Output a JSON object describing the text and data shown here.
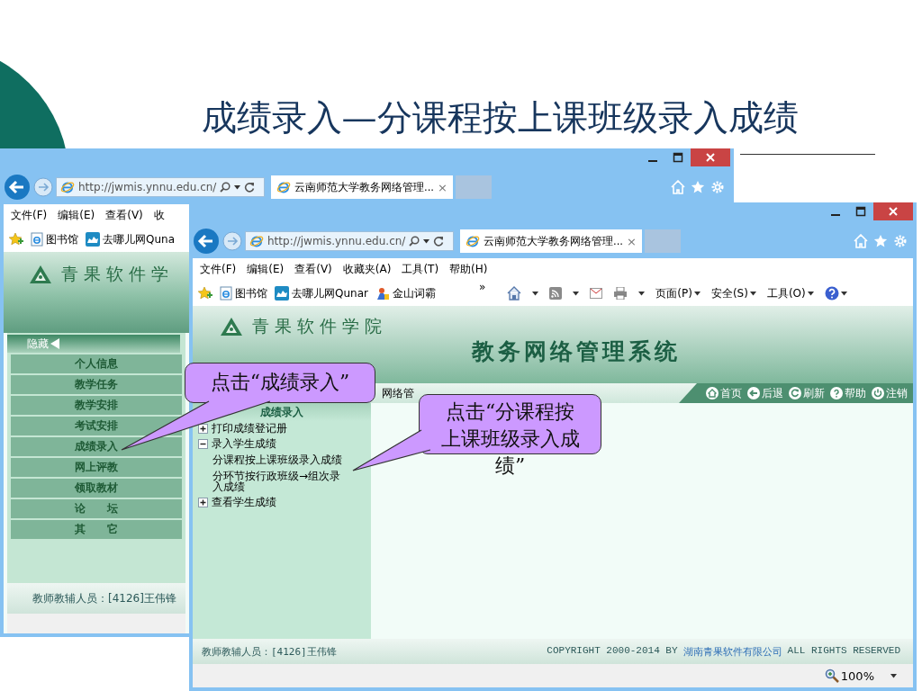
{
  "slide": {
    "title": "成绩录入—分课程按上课班级录入成绩"
  },
  "back_window": {
    "address": "http://jwmis.ynnu.edu.cn/",
    "tab": {
      "title": "云南师范大学教务网络管理...",
      "close": "×"
    },
    "menu": [
      "文件(F)",
      "编辑(E)",
      "查看(V)",
      "收"
    ],
    "favorites": [
      "图书馆",
      "去哪儿网Quna"
    ],
    "logo_text": "青果软件学",
    "sidebar": {
      "toggle": "隐藏",
      "items": [
        "个人信息",
        "教学任务",
        "教学安排",
        "考试安排",
        "成绩录入",
        "网上评教",
        "领取教材",
        "论　　坛",
        "其　　它"
      ]
    },
    "footer": "教师教辅人员：[4126]王伟锋"
  },
  "front_window": {
    "address": "http://jwmis.ynnu.edu.cn/",
    "tab": {
      "title": "云南师范大学教务网络管理...",
      "close": "×"
    },
    "menu": [
      "文件(F)",
      "编辑(E)",
      "查看(V)",
      "收藏夹(A)",
      "工具(T)",
      "帮助(H)"
    ],
    "favorites": [
      "图书馆",
      "去哪儿网Qunar",
      "金山词霸"
    ],
    "more": "»",
    "command_bar": [
      "页面(P)",
      "安全(S)",
      "工具(O)"
    ],
    "logo_text": "青果软件学院",
    "system_title": "教务网络管理系统",
    "location": "网络管",
    "nav": [
      "首页",
      "后退",
      "刷新",
      "帮助",
      "注销"
    ],
    "tree": {
      "title": "成绩录入",
      "items": [
        {
          "label": "打印成绩登记册",
          "expanded": false
        },
        {
          "label": "录入学生成绩",
          "expanded": true,
          "children": [
            {
              "label": "分课程按上课班级录入成绩"
            },
            {
              "label": "分环节按行政班级→组次录入成绩"
            }
          ]
        },
        {
          "label": "查看学生成绩",
          "expanded": false
        }
      ]
    },
    "footer": {
      "user": "教师教辅人员：[4126]王伟锋",
      "copyright_before": "COPYRIGHT 2000-2014 BY",
      "company_link": "湖南青果软件有限公司",
      "copyright_after": "ALL RIGHTS RESERVED"
    },
    "zoom": "100%"
  },
  "callouts": [
    {
      "text": "点击“成绩录入”"
    },
    {
      "text": "点击“分课程按上课班级录入成绩”"
    }
  ]
}
